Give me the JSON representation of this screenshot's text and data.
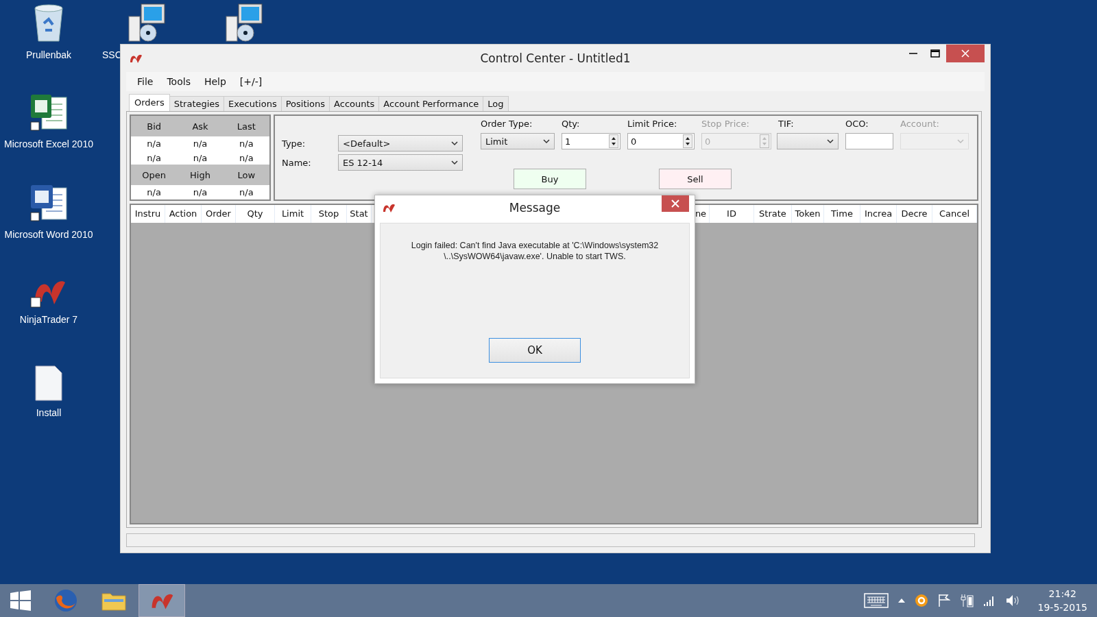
{
  "desktop_icons": [
    {
      "label": "Prullenbak",
      "kind": "recycle"
    },
    {
      "label": "Microsoft Excel 2010",
      "kind": "excel"
    },
    {
      "label": "Microsoft Word 2010",
      "kind": "word"
    },
    {
      "label": "NinjaTrader 7",
      "kind": "ninja"
    },
    {
      "label": "Install",
      "kind": "file"
    }
  ],
  "top_icons": [
    {
      "label": "SSC",
      "kind": "installer"
    },
    {
      "kind": "installer"
    }
  ],
  "window": {
    "title": "Control Center - Untitled1"
  },
  "menu": [
    "File",
    "Tools",
    "Help",
    "[+/-]"
  ],
  "tabs": [
    {
      "label": "Orders",
      "selected": true
    },
    {
      "label": "Strategies",
      "selected": false
    },
    {
      "label": "Executions",
      "selected": false
    },
    {
      "label": "Positions",
      "selected": false
    },
    {
      "label": "Accounts",
      "selected": false
    },
    {
      "label": "Account Performance",
      "selected": false
    },
    {
      "label": "Log",
      "selected": false
    }
  ],
  "quotes": [
    {
      "kind": "header",
      "cells": [
        "Bid",
        "Ask",
        "Last"
      ]
    },
    {
      "kind": "value",
      "cells": [
        "n/a",
        "n/a",
        "n/a"
      ]
    },
    {
      "kind": "value",
      "cells": [
        "n/a",
        "n/a",
        "n/a"
      ]
    },
    {
      "kind": "header",
      "cells": [
        "Open",
        "High",
        "Low"
      ]
    },
    {
      "kind": "value",
      "cells": [
        "n/a",
        "n/a",
        "n/a"
      ]
    }
  ],
  "order_form": {
    "type_label": "Type:",
    "type_value": "<Default>",
    "name_label": "Name:",
    "name_value": "ES 12-14",
    "fields": [
      {
        "label": "Order Type:",
        "kind": "dropdown",
        "value": "Limit",
        "disabled": false
      },
      {
        "label": "Qty:",
        "kind": "spinner",
        "value": "1",
        "disabled": false
      },
      {
        "label": "Limit Price:",
        "kind": "spinner",
        "value": "0",
        "disabled": false
      },
      {
        "label": "Stop Price:",
        "kind": "spinner",
        "value": "0",
        "disabled": true
      },
      {
        "label": "TIF:",
        "kind": "dropdown",
        "disabled": false
      },
      {
        "label": "OCO:",
        "kind": "text",
        "disabled": false
      },
      {
        "label": "Account:",
        "kind": "dropdown",
        "disabled": true
      }
    ],
    "buttons": [
      {
        "label": "Buy",
        "kind": "buy"
      },
      {
        "label": "Sell",
        "kind": "sell"
      }
    ]
  },
  "orders_table": {
    "columns_left": [
      "Instru",
      "Action",
      "Order",
      "Qty",
      "Limit",
      "Stop",
      "Stat"
    ],
    "columns_right": [
      "ne",
      "ID",
      "Strate",
      "Token",
      "Time",
      "Increa",
      "Decre",
      "Cancel"
    ]
  },
  "dialog": {
    "title": "Message",
    "message": "Login failed: Can't find Java executable at 'C:\\Windows\\system32\n\\..\\SysWOW64\\javaw.exe'. Unable to start TWS.",
    "button": "OK"
  },
  "taskbar": {
    "apps": [
      {
        "kind": "firefox",
        "selected": false
      },
      {
        "kind": "explorer",
        "selected": false
      },
      {
        "kind": "ninja",
        "selected": true
      }
    ],
    "time": "21:42",
    "date": "19-5-2015"
  }
}
